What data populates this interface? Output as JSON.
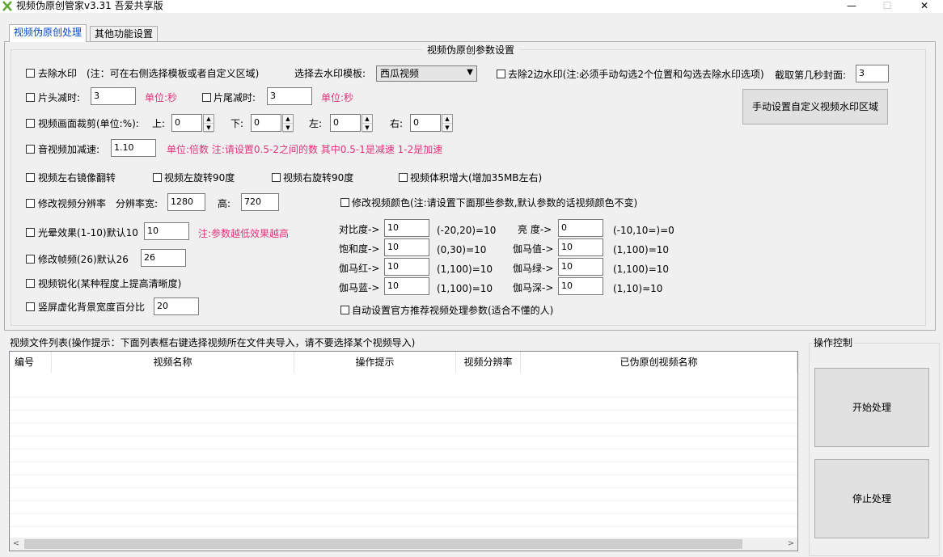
{
  "window": {
    "title": "视频伪原创管家v3.31 吾爱共享版",
    "minimize": "—",
    "maximize": "☐",
    "close": "✕"
  },
  "tabs": [
    {
      "label": "视频伪原创处理",
      "active": true
    },
    {
      "label": "其他功能设置",
      "active": false
    }
  ],
  "params": {
    "group_title": "视频伪原创参数设置",
    "remove_watermark": {
      "label": "去除水印",
      "note": "(注：可在右侧选择模板或者自定义区域)"
    },
    "template_label": "选择去水印模板:",
    "template_value": "西瓜视频",
    "remove_2_watermark": {
      "label": "去除2边水印(注:必须手动勾选2个位置和勾选去除水印选项)"
    },
    "cover_label": "截取第几秒封面:",
    "cover_value": "3",
    "head_cut": {
      "label": "片头减时:",
      "value": "3",
      "unit": "单位:秒"
    },
    "tail_cut": {
      "label": "片尾减时:",
      "value": "3",
      "unit": "单位:秒"
    },
    "manual_button": "手动设置自定义视频水印区域",
    "crop": {
      "label": "视频画面裁剪(单位:%):",
      "top_label": "上:",
      "top": "0",
      "bottom_label": "下:",
      "bottom": "0",
      "left_label": "左:",
      "left": "0",
      "right_label": "右:",
      "right": "0"
    },
    "speed": {
      "label": "音视频加减速:",
      "value": "1.10",
      "note": "单位:倍数 注:请设置0.5-2之间的数  其中0.5-1是减速  1-2是加速"
    },
    "mirror": "视频左右镜像翻转",
    "rotate_left": "视频左旋转90度",
    "rotate_right": "视频右旋转90度",
    "enlarge": "视频体积增大(增加35MB左右)",
    "resolution": {
      "label": "修改视频分辨率",
      "width_label": "分辨率宽:",
      "width": "1280",
      "height_label": "高:",
      "height": "720"
    },
    "color": {
      "label": "修改视频颜色(注:请设置下面那些参数,默认参数的话视频颜色不变)"
    },
    "color_params": [
      {
        "label": "对比度->",
        "value": "10",
        "range": "(-20,20)=10"
      },
      {
        "label": "亮  度->",
        "value": "0",
        "range": "(-10,10=)=0"
      },
      {
        "label": "饱和度->",
        "value": "10",
        "range": "(0,30)=10"
      },
      {
        "label": "伽马值->",
        "value": "10",
        "range": "(1,100)=10"
      },
      {
        "label": "伽马红->",
        "value": "10",
        "range": "(1,100)=10"
      },
      {
        "label": "伽马绿->",
        "value": "10",
        "range": "(1,100)=10"
      },
      {
        "label": "伽马蓝->",
        "value": "10",
        "range": "(1,100)=10"
      },
      {
        "label": "伽马深->",
        "value": "10",
        "range": "(1,10)=10"
      }
    ],
    "glow": {
      "label": "光晕效果(1-10)默认10",
      "value": "10",
      "note": "注:参数越低效果越高"
    },
    "fps": {
      "label": "修改帧频(26)默认26",
      "value": "26"
    },
    "sharpen": "视频锐化(某种程度上提高清晰度)",
    "blur_bg": {
      "label": "竖屏虚化背景宽度百分比",
      "value": "20"
    },
    "auto_params": "自动设置官方推荐视频处理参数(适合不懂的人)"
  },
  "file_list": {
    "title": "视频文件列表(操作提示：下面列表框右键选择视频所在文件夹导入，请不要选择某个视频导入)",
    "columns": [
      "编号",
      "视频名称",
      "操作提示",
      "视频分辨率",
      "已伪原创视频名称"
    ]
  },
  "control": {
    "title": "操作控制",
    "start": "开始处理",
    "stop": "停止处理"
  },
  "colors": {
    "accent_tab": "#0047c5",
    "note_red": "#e2337a"
  }
}
